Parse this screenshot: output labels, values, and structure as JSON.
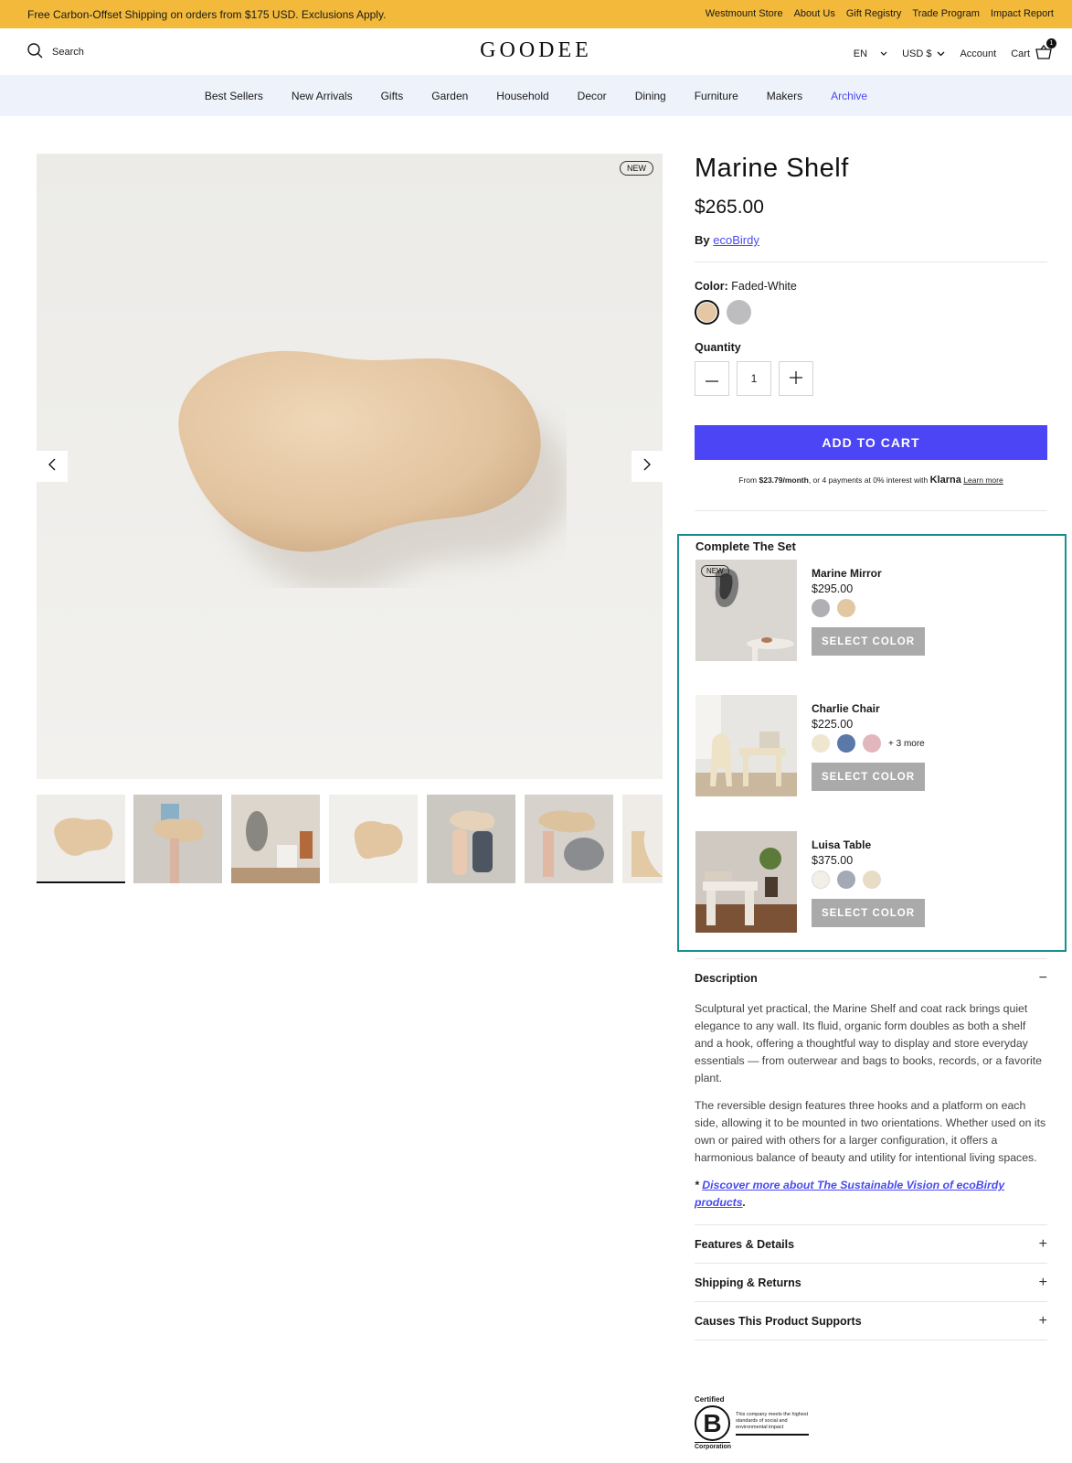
{
  "announcement": {
    "message": "Free Carbon-Offset Shipping on orders from $175 USD. Exclusions Apply.",
    "links": [
      "Westmount Store",
      "About Us",
      "Gift Registry",
      "Trade Program",
      "Impact Report"
    ]
  },
  "header": {
    "search_label": "Search",
    "logo": "GOODEE",
    "language": "EN",
    "currency": "USD $",
    "account_label": "Account",
    "cart_label": "Cart",
    "cart_count": "1"
  },
  "nav": {
    "items": [
      "Best Sellers",
      "New Arrivals",
      "Gifts",
      "Garden",
      "Household",
      "Decor",
      "Dining",
      "Furniture",
      "Makers",
      "Archive"
    ]
  },
  "gallery": {
    "badge": "NEW",
    "active_index": 0
  },
  "product": {
    "title": "Marine Shelf",
    "price": "$265.00",
    "by_label": "By",
    "maker": "ecoBirdy",
    "color_label": "Color:",
    "color_value": "Faded-White",
    "swatches": [
      "#e5c7a3",
      "#bdbcbf"
    ],
    "quantity_label": "Quantity",
    "quantity": "1",
    "add_to_cart": "ADD TO CART",
    "klarna": {
      "prefix": "From",
      "amount": "$23.79/month",
      "middle": ", or 4 payments at 0% interest with",
      "brand": "Klarna",
      "learn_more": "Learn more"
    }
  },
  "complete_set": {
    "title": "Complete The Set",
    "items": [
      {
        "name": "Marine Mirror",
        "price": "$295.00",
        "badge": "NEW",
        "swatches": [
          "#b0afb3",
          "#e3c7a0"
        ],
        "more": "",
        "button": "SELECT COLOR"
      },
      {
        "name": "Charlie Chair",
        "price": "$225.00",
        "badge": "",
        "swatches": [
          "#efe6cf",
          "#5a78a8",
          "#e1b7bb"
        ],
        "more": "+ 3 more",
        "button": "SELECT COLOR"
      },
      {
        "name": "Luisa Table",
        "price": "$375.00",
        "badge": "",
        "swatches": [
          "#f2eee8",
          "#a5a9b5",
          "#e8dcc6"
        ],
        "more": "",
        "button": "SELECT COLOR"
      }
    ]
  },
  "description": {
    "title": "Description",
    "collapse_symbol": "−",
    "p1": "Sculptural yet practical, the Marine Shelf and coat rack brings quiet elegance to any wall. Its fluid, organic form doubles as both a shelf and a hook, offering a thoughtful way to display and store everyday essentials — from outerwear and bags to books, records, or a favorite plant.",
    "p2": "The reversible design features three hooks and a platform on each side, allowing it to be mounted in two orientations. Whether used on its own or paired with others for a larger configuration, it offers a harmonious balance of beauty and utility for intentional living spaces.",
    "link_prefix": "* ",
    "link_text": "Discover more about The Sustainable Vision of ecoBirdy products",
    "link_suffix": "."
  },
  "accordions": [
    {
      "title": "Features & Details",
      "symbol": "+"
    },
    {
      "title": "Shipping & Returns",
      "symbol": "+"
    },
    {
      "title": "Causes This Product Supports",
      "symbol": "+"
    }
  ],
  "bcorp": {
    "certified": "Certified",
    "letter": "B",
    "corporation": "Corporation",
    "tagline": "This company meets the highest standards of social and environmental impact"
  },
  "colors": {
    "accent": "#4b45f5",
    "announcement_bg": "#f2b93b",
    "nav_bg": "#eef2fb",
    "highlight_border": "#1a8f92"
  }
}
